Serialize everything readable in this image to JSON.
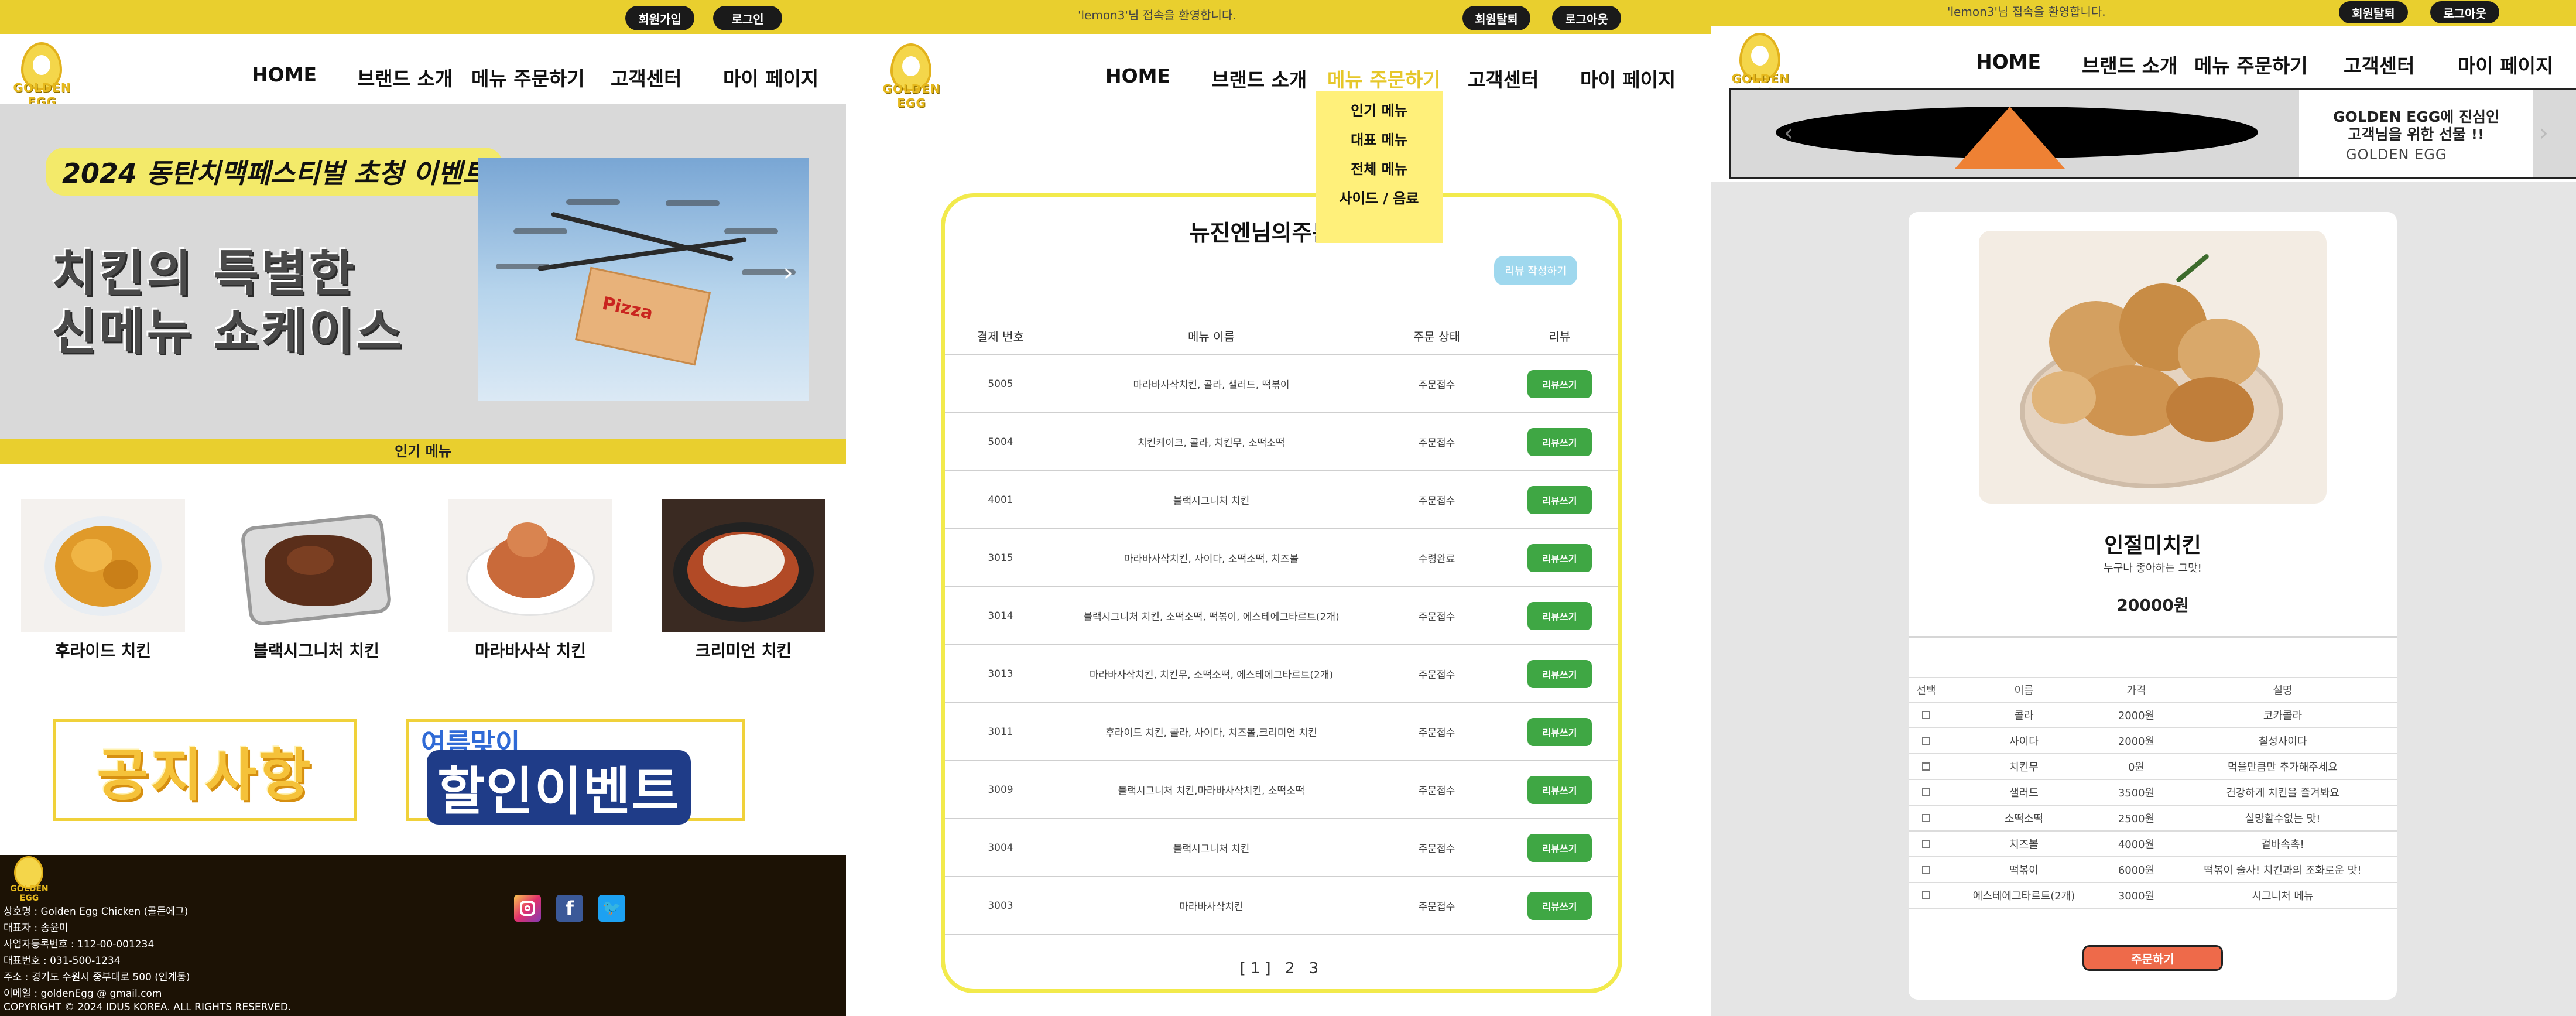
{
  "accent": "#e9cf2e",
  "panel1": {
    "topbar": {
      "signup_label": "회원가입",
      "login_label": "로그인"
    },
    "logo_text": "GOLDEN EGG",
    "nav": [
      "HOME",
      "브랜드 소개",
      "메뉴 주문하기",
      "고객센터",
      "마이 페이지"
    ],
    "hero": {
      "tag": "2024 동탄치맥페스티벌 초청 이벤트",
      "title_line1": "치킨의 특별한",
      "title_line2": "신메뉴 쇼케이스",
      "box_label": "Pizza",
      "next_arrow": "›"
    },
    "popular_label": "인기 메뉴",
    "menu_items": [
      {
        "name": "후라이드 치킨"
      },
      {
        "name": "블랙시그니처 치킨"
      },
      {
        "name": "마라바사삭 치킨"
      },
      {
        "name": "크리미언 치킨"
      }
    ],
    "promos": {
      "notice": "공지사항",
      "event_sub": "여름맞이",
      "event_main": "할인이벤트"
    },
    "footer": {
      "logo_text": "GOLDEN EGG",
      "lines": [
        "상호명 : Golden Egg Chicken (골든에그)",
        "대표자 : 송윤미",
        "사업자등록번호 : 112-00-001234",
        "대표번호 : 031-500-1234",
        "주소 : 경기도 수원시 중부대로 500 (인계동)",
        "이메일 : goldenEgg @ gmail.com",
        "COPYRIGHT © 2024 IDUS KOREA. ALL RIGHTS RESERVED."
      ],
      "social": [
        "instagram-icon",
        "facebook-icon",
        "twitter-icon"
      ]
    }
  },
  "panel2": {
    "topbar": {
      "welcome": "'lemon3'님 접속을 환영합니다.",
      "mypage_label": "회원탈퇴",
      "logout_label": "로그아웃"
    },
    "logo_text": "GOLDEN EGG",
    "nav": [
      "HOME",
      "브랜드 소개",
      "메뉴 주문하기",
      "고객센터",
      "마이 페이지"
    ],
    "dropdown": [
      "인기 메뉴",
      "대표 메뉴",
      "전체 메뉴",
      "사이드 / 음료"
    ],
    "order_title": "뉴진엔님의주문내역",
    "review_button": "리뷰 작성하기",
    "columns": [
      "결제 번호",
      "메뉴 이름",
      "주문 상태",
      "리뷰"
    ],
    "rows": [
      {
        "no": "5005",
        "menu": "마라바사삭치킨, 콜라, 샐러드, 떡볶이",
        "status": "주문접수",
        "action": "리뷰쓰기"
      },
      {
        "no": "5004",
        "menu": "치킨케이크, 콜라, 치킨무, 소떡소떡",
        "status": "주문접수",
        "action": "리뷰쓰기"
      },
      {
        "no": "4001",
        "menu": "블랙시그니처 치킨",
        "status": "주문접수",
        "action": "리뷰쓰기"
      },
      {
        "no": "3015",
        "menu": "마라바사삭치킨, 사이다, 소떡소떡, 치즈볼",
        "status": "수령완료",
        "action": "리뷰쓰기"
      },
      {
        "no": "3014",
        "menu": "블랙시그니처 치킨, 소떡소떡, 떡볶이, 에스테에그타르트(2개)",
        "status": "주문접수",
        "action": "리뷰쓰기"
      },
      {
        "no": "3013",
        "menu": "마라바사삭치킨, 치킨무, 소떡소떡, 에스테에그타르트(2개)",
        "status": "주문접수",
        "action": "리뷰쓰기"
      },
      {
        "no": "3011",
        "menu": "후라이드 치킨, 콜라, 사이다, 치즈볼,크리미언 치킨",
        "status": "주문접수",
        "action": "리뷰쓰기"
      },
      {
        "no": "3009",
        "menu": "블랙시그니처 치킨,마라바사삭치킨, 소떡소떡",
        "status": "주문접수",
        "action": "리뷰쓰기"
      },
      {
        "no": "3004",
        "menu": "블랙시그니처 치킨",
        "status": "주문접수",
        "action": "리뷰쓰기"
      },
      {
        "no": "3003",
        "menu": "마라바사삭치킨",
        "status": "주문접수",
        "action": "리뷰쓰기"
      }
    ],
    "pager": "[1] 2 3"
  },
  "panel3": {
    "topbar": {
      "welcome": "'lemon3'님 접속을 환영합니다.",
      "mypage_label": "회원탈퇴",
      "logout_label": "로그아웃"
    },
    "logo_text": "GOLDEN EGG",
    "nav": [
      "HOME",
      "브랜드 소개",
      "메뉴 주문하기",
      "고객센터",
      "마이 페이지"
    ],
    "slide": {
      "line1": "GOLDEN EGG에 진심인",
      "line2": "고객님을 위한 선물 !!",
      "sub": "GOLDEN EGG",
      "prev": "‹",
      "next": "›"
    },
    "product": {
      "name": "인절미치킨",
      "desc": "누구나 좋아하는 그맛!",
      "price": "20000원"
    },
    "option_columns": [
      "선택",
      "이름",
      "가격",
      "설명"
    ],
    "options": [
      {
        "name": "콜라",
        "price": "2000원",
        "desc": "코카콜라"
      },
      {
        "name": "사이다",
        "price": "2000원",
        "desc": "칠성사이다"
      },
      {
        "name": "치킨무",
        "price": "0원",
        "desc": "먹을만큼만 추가해주세요"
      },
      {
        "name": "샐러드",
        "price": "3500원",
        "desc": "건강하게 치킨을 즐겨봐요"
      },
      {
        "name": "소떡소떡",
        "price": "2500원",
        "desc": "실망할수없는 맛!"
      },
      {
        "name": "치즈볼",
        "price": "4000원",
        "desc": "겉바속촉!"
      },
      {
        "name": "떡볶이",
        "price": "6000원",
        "desc": "떡볶이 술사! 치킨과의 조화로운 맛!"
      },
      {
        "name": "에스테에그타르트(2개)",
        "price": "3000원",
        "desc": "시그니처 메뉴"
      }
    ],
    "order_button": "주문하기"
  }
}
